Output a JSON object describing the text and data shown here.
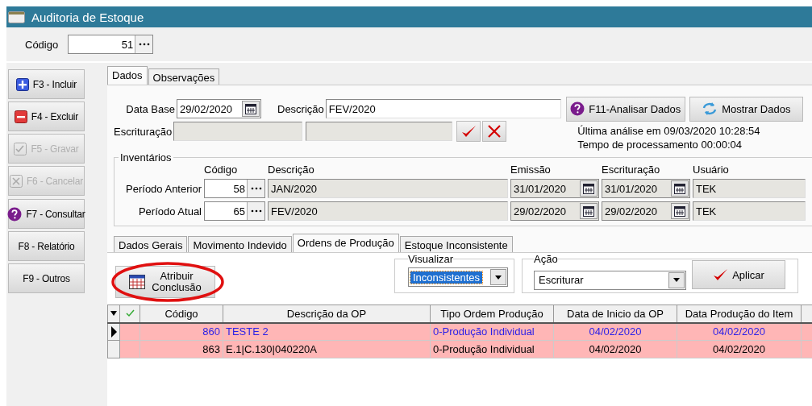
{
  "window": {
    "title": "Auditoria de Estoque"
  },
  "codigo": {
    "label": "Código",
    "value": "51"
  },
  "sidebar": [
    {
      "label": "F3 - Incluir",
      "kind": "plus",
      "disabled": false
    },
    {
      "label": "F4 - Excluir",
      "kind": "minus",
      "disabled": false
    },
    {
      "label": "F5 - Gravar",
      "kind": "check",
      "disabled": true
    },
    {
      "label": "F6 - Cancelar",
      "kind": "cross",
      "disabled": true
    },
    {
      "label": "F7 - Consultar",
      "kind": "help",
      "disabled": false
    },
    {
      "label": "F8 - Relatório",
      "kind": "plain",
      "disabled": false
    },
    {
      "label": "F9 - Outros",
      "kind": "plain",
      "disabled": false
    }
  ],
  "tabs": [
    {
      "label": "Dados",
      "selected": true
    },
    {
      "label": "Observações",
      "selected": false
    }
  ],
  "dados": {
    "data_base_label": "Data Base",
    "data_base": "29/02/2020",
    "descricao_label": "Descrição",
    "descricao": "FEV/2020",
    "analisar_button": "F11-Analisar Dados",
    "mostrar_button": "Mostrar Dados",
    "escrituracao_label": "Escrituração",
    "last_analysis": "Última análise em 09/03/2020 10:28:54",
    "processing_time": "Tempo de processamento 00:00:04"
  },
  "inventarios": {
    "title": "Inventários",
    "columns": [
      "Código",
      "Descrição",
      "Emissão",
      "Escrituração",
      "Usuário"
    ],
    "rows": [
      {
        "label": "Período Anterior",
        "codigo": "58",
        "descricao": "JAN/2020",
        "emissao": "31/01/2020",
        "escrituracao": "31/01/2020",
        "usuario": "TEK"
      },
      {
        "label": "Período Atual",
        "codigo": "65",
        "descricao": "FEV/2020",
        "emissao": "29/02/2020",
        "escrituracao": "29/02/2020",
        "usuario": "TEK"
      }
    ]
  },
  "subtabs": [
    {
      "label": "Dados Gerais",
      "selected": false
    },
    {
      "label": "Movimento Indevido",
      "selected": false
    },
    {
      "label": "Ordens de Produção",
      "selected": true
    },
    {
      "label": "Estoque Inconsistente",
      "selected": false
    }
  ],
  "atribuir": {
    "line1": "Atribuir",
    "line2": "Conclusão",
    "annotated": true
  },
  "visualizar": {
    "label": "Visualizar",
    "value": "Inconsistentes"
  },
  "acao": {
    "label": "Ação",
    "value": "Escriturar",
    "button": "Aplicar"
  },
  "table": {
    "columns": [
      "Código",
      "Descrição da OP",
      "Tipo Ordem Produção",
      "Data de Inicio da OP",
      "Data Produção do Item"
    ],
    "rows": [
      {
        "selected": true,
        "cells": [
          "860",
          "TESTE 2",
          "0-Produção Individual",
          "04/02/2020",
          "04/02/2020"
        ]
      },
      {
        "selected": false,
        "cells": [
          "863",
          "E.1|C.130|040220A",
          "0-Produção Individual",
          "04/02/2020",
          "04/02/2020"
        ]
      }
    ]
  }
}
